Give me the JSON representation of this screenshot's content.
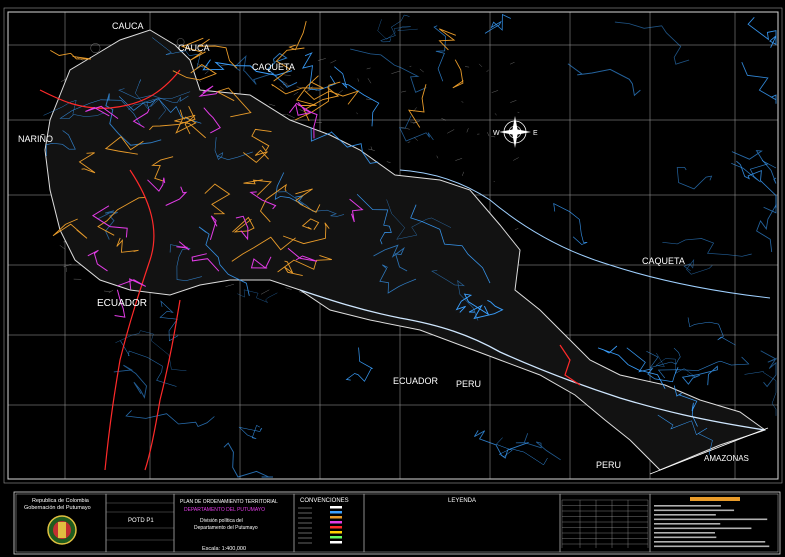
{
  "map": {
    "region_labels": [
      {
        "id": "cauca-1",
        "text": "CAUCA"
      },
      {
        "id": "cauca-2",
        "text": "CAUCA"
      },
      {
        "id": "caqueta-1",
        "text": "CAQUETA"
      },
      {
        "id": "narino",
        "text": "NARIÑO"
      },
      {
        "id": "ecuador-1",
        "text": "ECUADOR"
      },
      {
        "id": "ecuador-2",
        "text": "ECUADOR"
      },
      {
        "id": "peru-1",
        "text": "PERU"
      },
      {
        "id": "caqueta-2",
        "text": "CAQUETA"
      },
      {
        "id": "peru-2",
        "text": "PERU"
      },
      {
        "id": "amazonas",
        "text": "AMAZONAS"
      }
    ],
    "colors": {
      "background": "#000000",
      "grid": "#cfcfcf",
      "rivers": "#3aa0ff",
      "roads_orange": "#e89b2a",
      "roads_magenta": "#e23ce6",
      "border_red": "#ff2a2a",
      "relief": "#d9d9d9"
    },
    "compass_icon": "compass-rose-icon"
  },
  "title_block": {
    "republic": "Republica de Colombia",
    "government": "Gobernación del Putumayo",
    "project": "POTD P1",
    "plan_title": "PLAN DE ORDENAMIENTO TERRITORIAL",
    "department": "DEPARTAMENTO DEL PUTUMAYO",
    "subtitle": "División política del",
    "subtitle2": "Departamento del Putumayo",
    "scale": "Escala: 1:400,000",
    "conventions_title": "CONVENCIONES",
    "legend_title": "LEYENDA",
    "seal_icon": "department-seal-icon"
  }
}
